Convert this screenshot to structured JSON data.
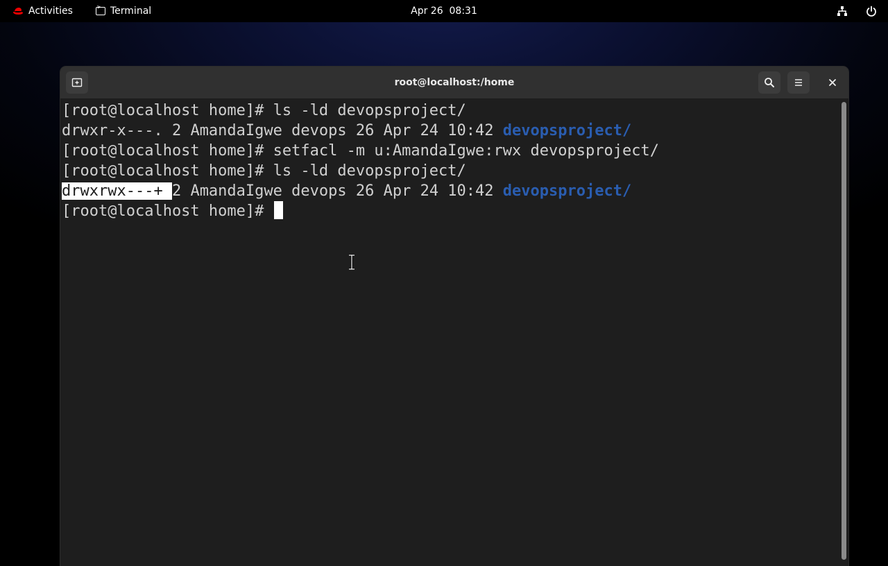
{
  "topbar": {
    "activities_label": "Activities",
    "app_label": "Terminal",
    "clock": "Apr 26  08:31",
    "icons": [
      "redhat-icon",
      "terminal-icon",
      "network-icon",
      "power-icon"
    ]
  },
  "window": {
    "title": "root@localhost:/home",
    "buttons": [
      "new-tab-icon",
      "search-icon",
      "menu-icon",
      "close-icon"
    ]
  },
  "terminal": {
    "lines": [
      {
        "prompt": "[root@localhost home]# ",
        "command": "ls -ld devopsproject/"
      },
      {
        "perms": "drwxr-x---.",
        "rest": " 2 AmandaIgwe devops 26 Apr 24 10:42 ",
        "dirname": "devopsproject/"
      },
      {
        "prompt": "[root@localhost home]# ",
        "command": "setfacl -m u:AmandaIgwe:rwx devopsproject/"
      },
      {
        "prompt": "[root@localhost home]# ",
        "command": "ls -ld devopsproject/"
      },
      {
        "perms": "drwxrwx---+ ",
        "rest": "2 AmandaIgwe devops 26 Apr 24 10:42 ",
        "dirname": "devopsproject/"
      },
      {
        "prompt": "[root@localhost home]# ",
        "command": ""
      }
    ],
    "selected_text": "drwxrwx---+ "
  },
  "colors": {
    "directory": "#2a5db0",
    "terminal_bg": "#1e1e1e",
    "headerbar_bg": "#303030",
    "redhat": "#ee0000"
  }
}
